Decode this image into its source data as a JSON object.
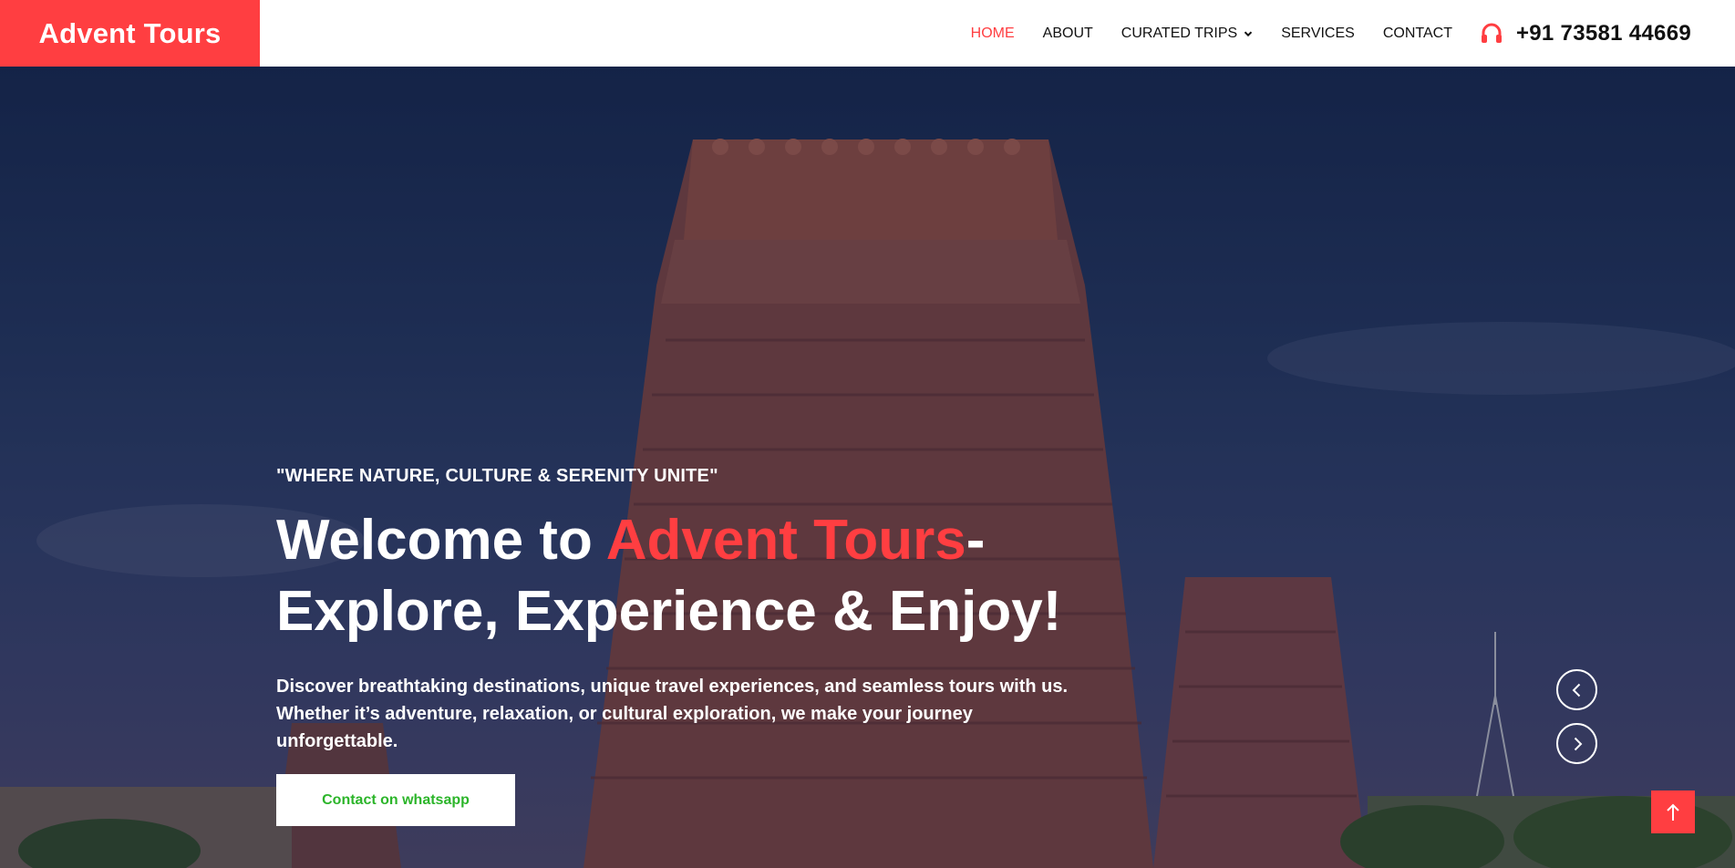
{
  "brand": {
    "title": "Advent Tours",
    "color": "#ff3e41"
  },
  "nav": {
    "items": [
      {
        "label": "HOME",
        "active": true
      },
      {
        "label": "ABOUT",
        "active": false
      },
      {
        "label": "CURATED TRIPS",
        "active": false,
        "has_dropdown": true,
        "icon": "chevron-down-icon"
      },
      {
        "label": "SERVICES",
        "active": false
      },
      {
        "label": "CONTACT",
        "active": false
      }
    ],
    "phone": {
      "icon": "headphones-icon",
      "number": "+91 73581 44669"
    }
  },
  "hero": {
    "tagline": "\"WHERE NATURE, CULTURE & SERENITY UNITE\"",
    "headline_prefix": "Welcome to ",
    "headline_accent": "Advent Tours",
    "headline_suffix": "-",
    "headline_line2": "Explore, Experience & Enjoy!",
    "description": "Discover breathtaking destinations, unique travel experiences, and seamless tours with us. Whether it’s adventure, relaxation, or cultural exploration, we make your journey unforgettable.",
    "cta_label": "Contact on whatsapp",
    "cta_color": "#2cb52a",
    "carousel": {
      "prev_icon": "chevron-left-icon",
      "next_icon": "chevron-right-icon"
    }
  },
  "back_to_top": {
    "icon": "arrow-up-icon"
  }
}
